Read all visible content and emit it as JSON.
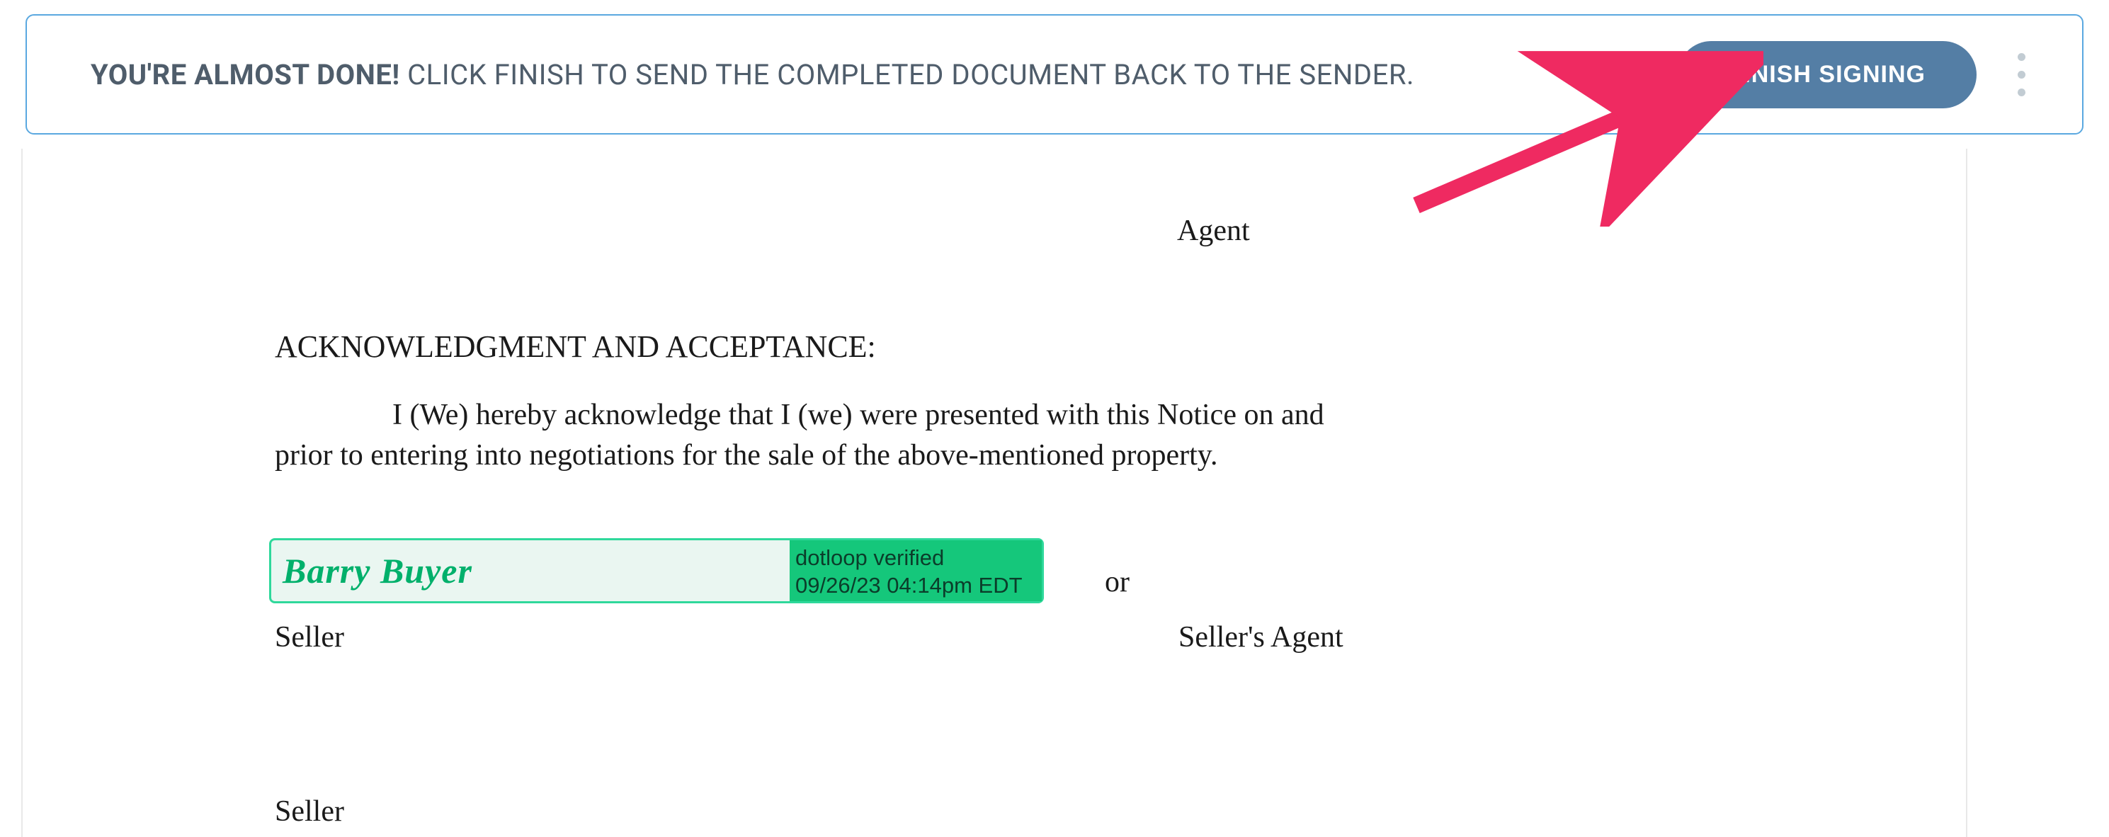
{
  "banner": {
    "bold": "YOU'RE ALMOST DONE!",
    "rest": " CLICK FINISH TO SEND THE COMPLETED DOCUMENT BACK TO THE SENDER.",
    "button": "FINISH SIGNING"
  },
  "document": {
    "agent_label": "Agent",
    "ack_heading": "ACKNOWLEDGMENT AND ACCEPTANCE:",
    "ack_body": "I (We) hereby acknowledge that I (we) were presented with this Notice on and prior to entering into negotiations for the sale of the above-mentioned property.",
    "or": "or",
    "seller_label_1": "Seller",
    "sellers_agent_label": "Seller's Agent",
    "seller_label_2": "Seller"
  },
  "signature": {
    "name": "Barry Buyer",
    "verified_line1": "dotloop verified",
    "verified_line2": "09/26/23 04:14pm EDT"
  }
}
